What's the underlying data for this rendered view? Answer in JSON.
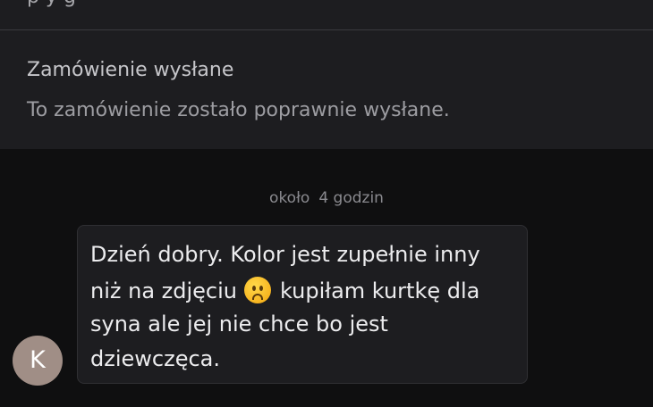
{
  "status": {
    "title": "Zamówienie wysłane",
    "description": "To zamówienie zostało poprawnie wysłane."
  },
  "timestamp": {
    "prefix": "około",
    "value": "4 godzin"
  },
  "message": {
    "avatar_initial": "K",
    "line1": "Dzień dobry. Kolor jest zupełnie inny",
    "line2_before_emoji": "niż na zdjęciu",
    "emoji": "sad-face-emoji",
    "line2_after_emoji": "kupiłam kurtkę dla",
    "line3": "syna ale jej nie chce bo jest",
    "line4": "dziewczęca."
  }
}
